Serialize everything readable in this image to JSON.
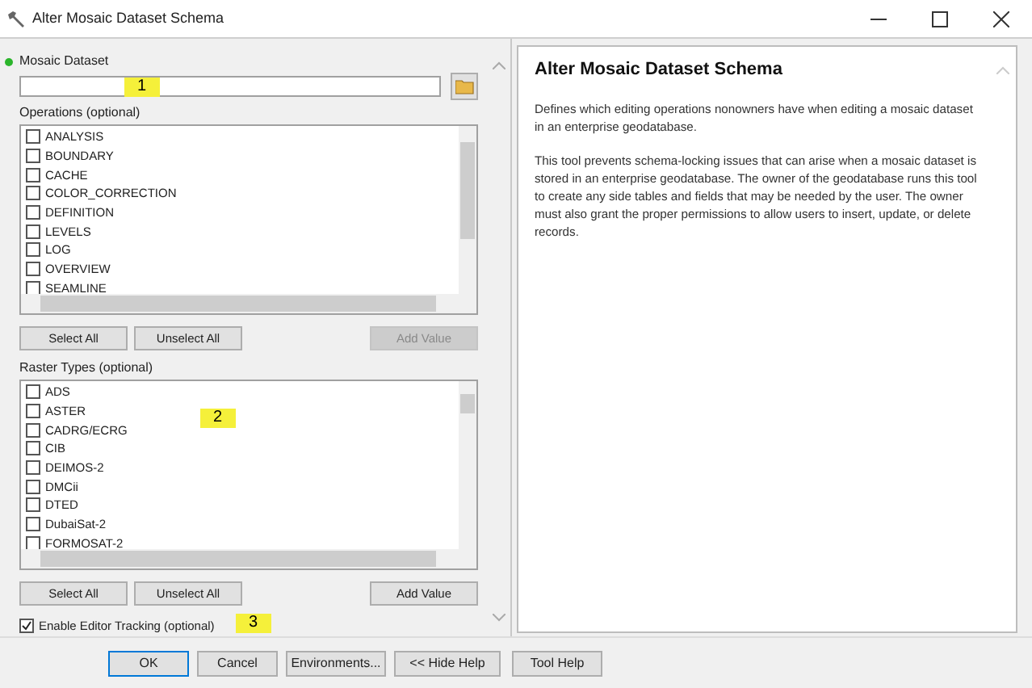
{
  "window": {
    "title": "Alter Mosaic Dataset Schema"
  },
  "mosaic_dataset": {
    "label": "Mosaic Dataset"
  },
  "operations": {
    "label": "Operations (optional)",
    "items": [
      {
        "label": "ANALYSIS",
        "checked": false
      },
      {
        "label": "BOUNDARY",
        "checked": false
      },
      {
        "label": "CACHE",
        "checked": false
      },
      {
        "label": "COLOR_CORRECTION",
        "checked": false
      },
      {
        "label": "DEFINITION",
        "checked": false
      },
      {
        "label": "LEVELS",
        "checked": false
      },
      {
        "label": "LOG",
        "checked": false
      },
      {
        "label": "OVERVIEW",
        "checked": false
      },
      {
        "label": "SEAMLINE",
        "checked": false
      }
    ],
    "buttons": [
      {
        "label": "Select All",
        "disabled": false
      },
      {
        "label": "Unselect All",
        "disabled": false
      },
      {
        "label": "Add Value",
        "disabled": true
      }
    ]
  },
  "raster_types": {
    "label": "Raster Types (optional)",
    "items": [
      {
        "label": "ADS",
        "checked": false
      },
      {
        "label": "ASTER",
        "checked": false
      },
      {
        "label": "CADRG/ECRG",
        "checked": false
      },
      {
        "label": "CIB",
        "checked": false
      },
      {
        "label": "DEIMOS-2",
        "checked": false
      },
      {
        "label": "DMCii",
        "checked": false
      },
      {
        "label": "DTED",
        "checked": false
      },
      {
        "label": "DubaiSat-2",
        "checked": false
      },
      {
        "label": "FORMOSAT-2",
        "checked": false
      }
    ],
    "buttons": [
      {
        "label": "Select All",
        "disabled": false
      },
      {
        "label": "Unselect All",
        "disabled": false
      },
      {
        "label": "Add Value",
        "disabled": false
      }
    ]
  },
  "editor_tracking": {
    "label": "Enable Editor Tracking (optional)",
    "checked": true
  },
  "annotations": [
    {
      "label": "1"
    },
    {
      "label": "2"
    },
    {
      "label": "3"
    }
  ],
  "footer_buttons": [
    {
      "label": "OK",
      "default": true
    },
    {
      "label": "Cancel",
      "default": false
    },
    {
      "label": "Environments...",
      "default": false
    },
    {
      "label": "<< Hide Help",
      "default": false
    },
    {
      "label": "Tool Help",
      "default": false
    }
  ],
  "help": {
    "title": "Alter Mosaic Dataset Schema",
    "paragraphs": [
      "Defines which editing operations nonowners have when editing a mosaic dataset in an enterprise geodatabase.",
      "This tool prevents schema-locking issues that can arise when a mosaic dataset is stored in an enterprise geodatabase. The owner of the geodatabase runs this tool to create any side tables and fields that may be needed by the user. The owner must also grant the proper permissions to allow users to insert, update, or delete records."
    ]
  }
}
